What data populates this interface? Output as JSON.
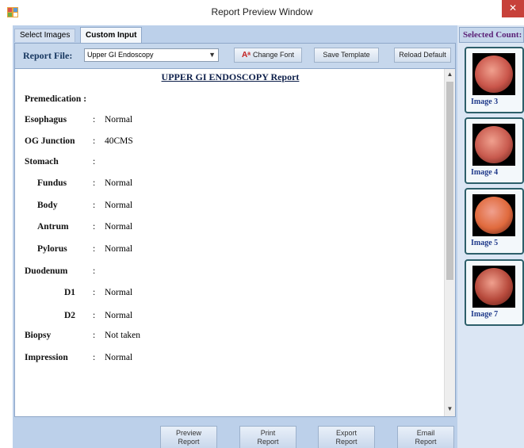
{
  "window": {
    "title": "Report Preview Window",
    "close_glyph": "✕",
    "icon": "app-icon"
  },
  "tabs": [
    {
      "label": "Select Images",
      "active": false
    },
    {
      "label": "Custom Input",
      "active": true
    }
  ],
  "toolbar": {
    "report_file_label": "Report File:",
    "report_file_value": "Upper GI Endoscopy",
    "change_font_label": "Change Font",
    "save_template_label": "Save Template",
    "reload_default_label": "Reload Default"
  },
  "report": {
    "title": "UPPER GI ENDOSCOPY Report",
    "rows": [
      {
        "label": "Premedication :",
        "colon": "",
        "value": "",
        "level": 0
      },
      {
        "label": "Esophagus",
        "colon": ":",
        "value": "Normal",
        "level": 0
      },
      {
        "label": "OG Junction",
        "colon": ":",
        "value": "40CMS",
        "level": 0
      },
      {
        "label": "Stomach",
        "colon": ":",
        "value": "",
        "level": 0
      },
      {
        "label": "Fundus",
        "colon": ":",
        "value": "Normal",
        "level": 1
      },
      {
        "label": "Body",
        "colon": ":",
        "value": "Normal",
        "level": 1
      },
      {
        "label": "Antrum",
        "colon": ":",
        "value": "Normal",
        "level": 1
      },
      {
        "label": "Pylorus",
        "colon": ":",
        "value": "Normal",
        "level": 1
      },
      {
        "label": "Duodenum",
        "colon": ":",
        "value": "",
        "level": 0
      },
      {
        "label": "D1",
        "colon": ":",
        "value": "Normal",
        "level": 2
      },
      {
        "label": "D2",
        "colon": ":",
        "value": "Normal",
        "level": 2
      },
      {
        "label": "Biopsy",
        "colon": ":",
        "value": "Not taken",
        "level": 0
      },
      {
        "label": "Impression",
        "colon": ":",
        "value": "Normal",
        "level": 0
      }
    ]
  },
  "bottom_buttons": {
    "preview": [
      "Preview",
      "Report"
    ],
    "print": [
      "Print",
      "Report"
    ],
    "export": [
      "Export",
      "Report"
    ],
    "email": [
      "Email",
      "Report"
    ]
  },
  "sidebar": {
    "selected_count_label": "Selected Count:",
    "images": [
      {
        "label": "Image 3",
        "color": "#c9554a"
      },
      {
        "label": "Image 4",
        "color": "#c85a4e"
      },
      {
        "label": "Image 5",
        "color": "#e06a3d"
      },
      {
        "label": "Image 7",
        "color": "#b74a3c"
      }
    ]
  },
  "colors": {
    "accent": "#5a1f76",
    "report_title": "#0d1f4a",
    "close_button": "#c7413a"
  }
}
